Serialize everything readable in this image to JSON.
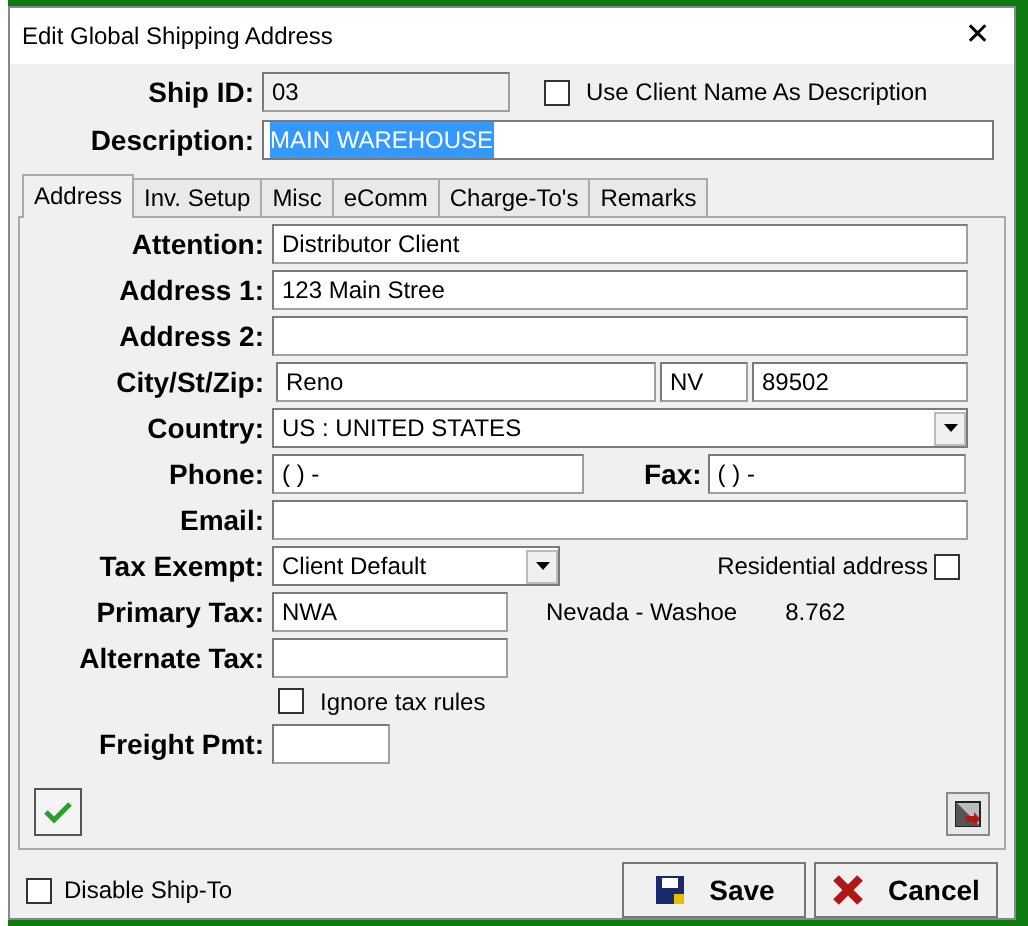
{
  "window": {
    "title": "Edit Global Shipping Address",
    "close": "✕"
  },
  "ship_id": {
    "label": "Ship ID:",
    "value": "03",
    "disabled": true
  },
  "use_client_name": {
    "label": "Use Client Name As Description",
    "checked": false
  },
  "description": {
    "label": "Description:",
    "value": "MAIN WAREHOUSE",
    "selected": true
  },
  "tabs": [
    {
      "label": "Address",
      "selected": true
    },
    {
      "label": "Inv. Setup",
      "selected": false
    },
    {
      "label": "Misc",
      "selected": false
    },
    {
      "label": "eComm",
      "selected": false
    },
    {
      "label": "Charge-To's",
      "selected": false
    },
    {
      "label": "Remarks",
      "selected": false
    }
  ],
  "address": {
    "attention": {
      "label": "Attention:",
      "value": "Distributor Client"
    },
    "address1": {
      "label": "Address 1:",
      "value": "123 Main Stree"
    },
    "address2": {
      "label": "Address 2:"
    },
    "city_st_zip": {
      "label": "City/St/Zip:",
      "city": "Reno",
      "state": "NV",
      "zip": "89502"
    },
    "country": {
      "label": "Country:",
      "value": "US : UNITED STATES"
    },
    "phone": {
      "label": "Phone:",
      "value": "(  )   -"
    },
    "fax": {
      "label": "Fax:",
      "value": "(  )   -"
    },
    "email": {
      "label": "Email:"
    },
    "tax_exempt": {
      "label": "Tax Exempt:",
      "value": "Client Default"
    },
    "residential": {
      "label": "Residential address",
      "checked": false
    },
    "primary_tax": {
      "label": "Primary Tax:",
      "value": "NWA",
      "name": "Nevada - Washoe",
      "rate": "8.762"
    },
    "alternate_tax": {
      "label": "Alternate Tax:"
    },
    "ignore_tax_rules": {
      "label": "Ignore tax rules",
      "checked": false
    },
    "freight_pmt": {
      "label": "Freight Pmt:"
    }
  },
  "disable_ship_to": {
    "label": "Disable Ship-To",
    "checked": false
  },
  "buttons": [
    {
      "kind": "save",
      "label": "Save"
    },
    {
      "kind": "cancel",
      "label": "Cancel"
    }
  ]
}
